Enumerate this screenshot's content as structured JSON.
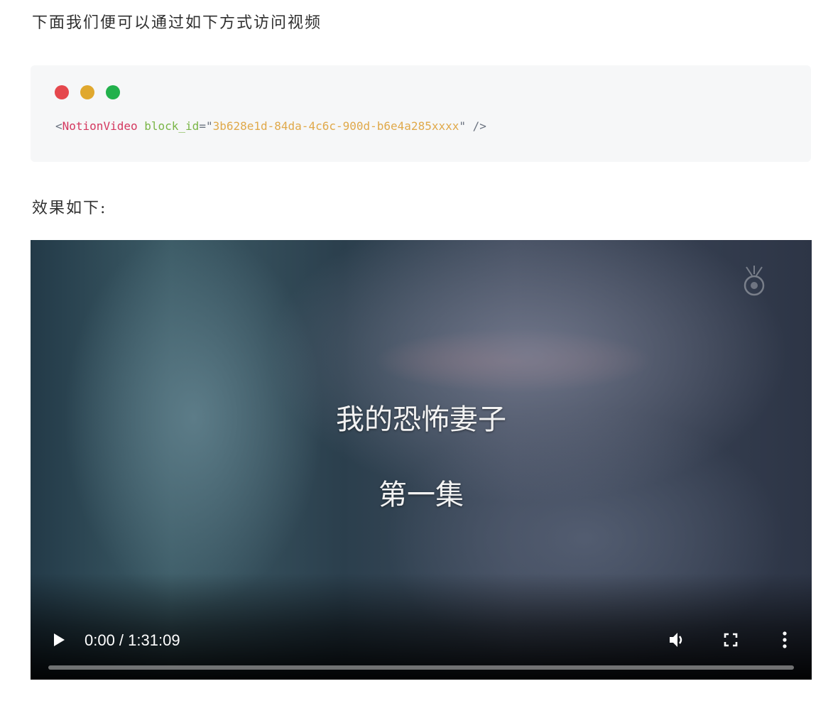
{
  "intro_text": "下面我们便可以通过如下方式访问视频",
  "code_block": {
    "window_dots": [
      "#e5484d",
      "#e0a82e",
      "#22b14c"
    ],
    "open_bracket": "<",
    "tag": "NotionVideo",
    "attr_name": "block_id",
    "equals_quote": "=\"",
    "attr_value": "3b628e1d-84da-4c6c-900d-b6e4a285xxxx",
    "close": "\" />"
  },
  "result_text": "效果如下:",
  "video": {
    "subtitle_line1": "我的恐怖妻子",
    "subtitle_line2": "第一集",
    "time_display": "0:00 / 1:31:09",
    "progress": 0,
    "icons": {
      "play": "play-icon",
      "volume": "volume-icon",
      "fullscreen": "fullscreen-icon",
      "more": "more-options-icon",
      "watermark": "channel-logo-icon"
    }
  }
}
